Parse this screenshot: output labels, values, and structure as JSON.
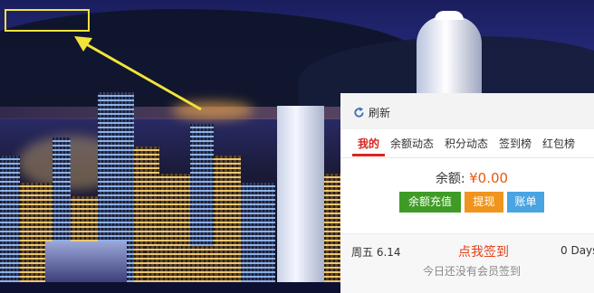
{
  "panel": {
    "refresh_label": "刷新",
    "tabs": [
      {
        "label": "我的",
        "active": true
      },
      {
        "label": "余额动态",
        "active": false
      },
      {
        "label": "积分动态",
        "active": false
      },
      {
        "label": "签到榜",
        "active": false
      },
      {
        "label": "红包榜",
        "active": false
      }
    ],
    "balance": {
      "label": "余额:",
      "value": "¥0.00"
    },
    "buttons": {
      "recharge": "余额充值",
      "withdraw": "提现",
      "bill": "账单"
    },
    "signin": {
      "weekday": "周五",
      "date": "6.14",
      "action": "点我签到",
      "days": "0 Days",
      "note": "今日还没有会员签到"
    }
  },
  "colors": {
    "accent_red": "#d8261f",
    "balance_orange": "#e8590c",
    "btn_green": "#3f9b25",
    "btn_orange": "#f0941e",
    "btn_blue": "#4aa3e3",
    "highlight_yellow": "#f2e33a"
  },
  "icons": {
    "refresh": "refresh-icon",
    "arrow": "annotation-arrow-icon"
  }
}
